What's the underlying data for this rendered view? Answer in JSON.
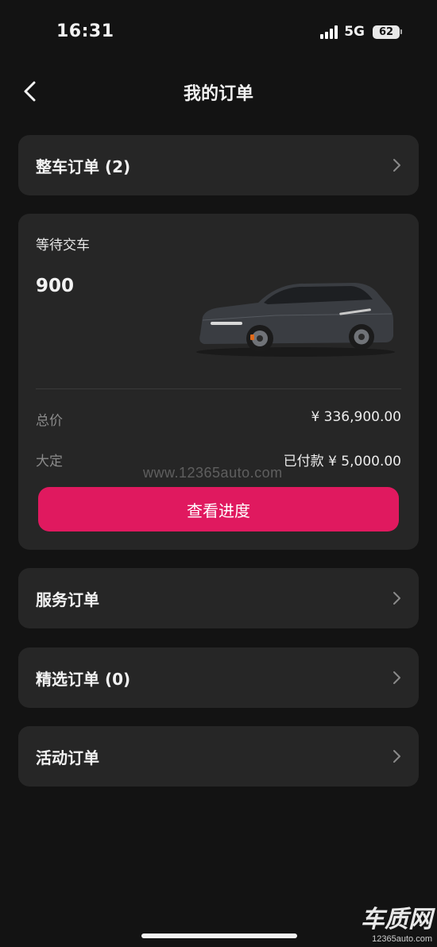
{
  "status_bar": {
    "time": "16:31",
    "network": "5G",
    "battery": "62"
  },
  "nav": {
    "title": "我的订单"
  },
  "vehicle_orders": {
    "label": "整车订单 (2)"
  },
  "order_card": {
    "status": "等待交车",
    "model": "900",
    "total_label": "总价",
    "total_value": "¥ 336,900.00",
    "deposit_label": "大定",
    "deposit_value": "已付款 ¥ 5,000.00",
    "button_label": "查看进度"
  },
  "rows": [
    {
      "label": "服务订单"
    },
    {
      "label": "精选订单 (0)"
    },
    {
      "label": "活动订单"
    }
  ],
  "watermark": "www.12365auto.com",
  "logo": {
    "main": "车质网",
    "sub": "12365auto.com"
  },
  "colors": {
    "background": "#131313",
    "card": "#262626",
    "accent": "#e0195f"
  }
}
